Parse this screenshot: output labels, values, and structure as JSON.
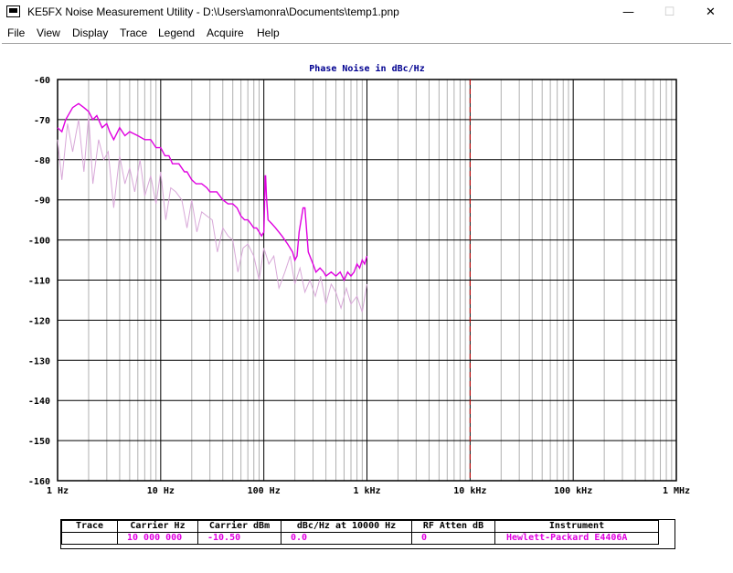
{
  "window": {
    "title": "KE5FX Noise Measurement Utility - D:\\Users\\amonra\\Documents\\temp1.pnp",
    "minimize_glyph": "—",
    "maximize_glyph": "☐",
    "close_glyph": "✕"
  },
  "menu": [
    "File",
    "View",
    "Display",
    "Trace",
    "Legend",
    "Acquire",
    "Help"
  ],
  "colors": {
    "trace": "#e000e0",
    "trace_raw": "#d8a8d8",
    "title": "#000090",
    "marker": "#d00000",
    "grid_major": "#000000",
    "grid_minor": "#b0b0b0"
  },
  "chart_data": {
    "type": "line",
    "title": "Phase Noise in dBc/Hz",
    "x_scale": "log",
    "xlim": [
      1,
      1000000
    ],
    "ylim": [
      -160,
      -60
    ],
    "x_ticks": [
      1,
      10,
      100,
      1000,
      10000,
      100000,
      1000000
    ],
    "x_tick_labels": [
      "1 Hz",
      "10 Hz",
      "100 Hz",
      "1 kHz",
      "10 kHz",
      "100 kHz",
      "1 MHz"
    ],
    "y_ticks": [
      -60,
      -70,
      -80,
      -90,
      -100,
      -110,
      -120,
      -130,
      -140,
      -150,
      -160
    ],
    "y_tick_labels": [
      "-60",
      "-70",
      "-80",
      "-90",
      "-100",
      "-110",
      "-120",
      "-130",
      "-140",
      "-150",
      "-160"
    ],
    "grid": true,
    "marker_x": 10000,
    "series": [
      {
        "x": [
          1,
          1.1,
          1.2,
          1.4,
          1.6,
          1.8,
          2,
          2.2,
          2.4,
          2.7,
          3,
          3.2,
          3.5,
          4,
          4.5,
          5,
          6,
          7,
          8,
          9,
          10,
          11,
          12,
          13,
          15,
          17,
          18,
          20,
          22,
          25,
          28,
          30,
          35,
          40,
          45,
          50,
          55,
          60,
          65,
          70,
          75,
          80,
          85,
          90,
          95,
          100,
          101,
          103,
          104,
          106,
          110,
          120,
          130,
          150,
          170,
          190,
          200,
          210,
          220,
          240,
          250,
          270,
          300,
          320,
          350,
          380,
          400,
          450,
          500,
          550,
          600,
          650,
          700,
          750,
          800,
          850,
          900,
          950,
          1000
        ],
        "y": [
          -72,
          -73,
          -70,
          -67,
          -66,
          -67,
          -68,
          -70,
          -69,
          -72,
          -71,
          -73,
          -75,
          -72,
          -74,
          -73,
          -74,
          -75,
          -75,
          -77,
          -77,
          -79,
          -79,
          -81,
          -81,
          -83,
          -83,
          -85,
          -86,
          -86,
          -87,
          -88,
          -88,
          -90,
          -91,
          -91,
          -92,
          -94,
          -95,
          -95,
          -96,
          -97,
          -97,
          -98,
          -99,
          -98,
          -94,
          -84,
          -84,
          -89,
          -95,
          -96,
          -97,
          -99,
          -101,
          -103,
          -105,
          -104,
          -98,
          -92,
          -92,
          -103,
          -106,
          -108,
          -107,
          -108,
          -109,
          -108,
          -109,
          -108,
          -110,
          -108,
          -109,
          -108,
          -106,
          -107,
          -105,
          -106,
          -104
        ]
      },
      {
        "x": [
          1,
          1.1,
          1.25,
          1.4,
          1.6,
          1.8,
          2,
          2.2,
          2.5,
          2.8,
          3.1,
          3.5,
          4,
          4.5,
          5,
          5.6,
          6.3,
          7,
          8,
          9,
          10,
          11.2,
          12.5,
          14,
          16,
          18,
          20,
          22.4,
          25,
          28,
          31.6,
          35.5,
          40,
          45,
          50,
          56,
          63,
          70,
          80,
          90,
          100,
          112,
          125,
          140,
          160,
          180,
          200,
          224,
          250,
          280,
          316,
          355,
          400,
          450,
          500,
          560,
          630,
          700,
          800,
          900,
          1000
        ],
        "y": [
          -75,
          -85,
          -71,
          -78,
          -70,
          -83,
          -69,
          -86,
          -75,
          -80,
          -78,
          -92,
          -79,
          -86,
          -82,
          -88,
          -80,
          -89,
          -84,
          -91,
          -83,
          -95,
          -87,
          -88,
          -90,
          -97,
          -90,
          -98,
          -93,
          -94,
          -95,
          -103,
          -97,
          -99,
          -100,
          -108,
          -102,
          -101,
          -104,
          -110,
          -102,
          -106,
          -104,
          -112,
          -108,
          -104,
          -111,
          -107,
          -113,
          -110,
          -114,
          -109,
          -116,
          -111,
          -113,
          -117,
          -112,
          -116,
          -114,
          -118,
          -111
        ]
      }
    ],
    "legend_table": {
      "headers": [
        "Trace",
        "Carrier Hz",
        "Carrier dBm",
        "dBc/Hz at 10000 Hz",
        "RF Atten dB",
        "Instrument"
      ],
      "rows": [
        [
          "",
          "10 000 000",
          "-10.50",
          "0.0",
          "0",
          "Hewlett-Packard E4406A"
        ]
      ]
    }
  }
}
